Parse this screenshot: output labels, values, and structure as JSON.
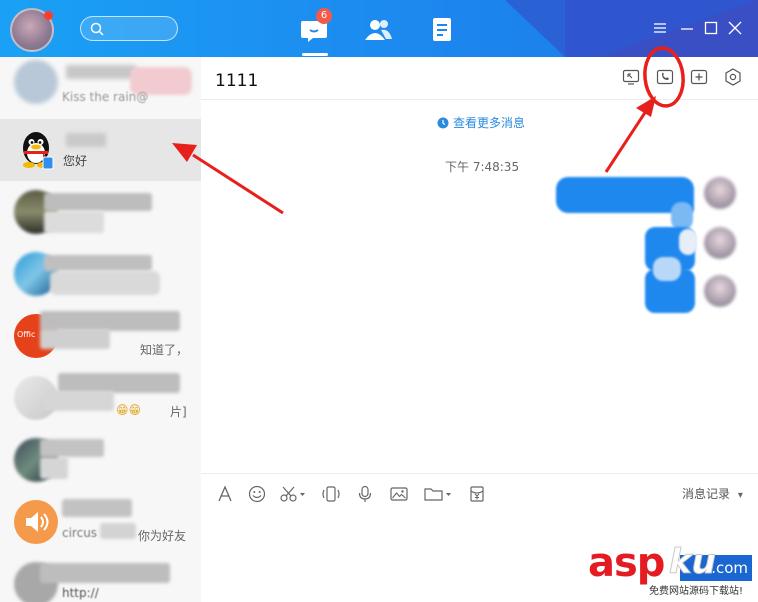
{
  "topbar": {
    "search_icon": "search-icon",
    "nav": [
      {
        "name": "chat-icon",
        "badge": "6"
      },
      {
        "name": "contacts-icon"
      },
      {
        "name": "space-icon"
      }
    ],
    "window_controls": [
      "menu-icon",
      "minimize-icon",
      "maximize-icon",
      "close-icon"
    ],
    "accent_color": "#1d86ee"
  },
  "sidebar": {
    "items": [
      {
        "preview": "Kiss the rain@"
      },
      {
        "preview": "您好"
      },
      {
        "preview": ""
      },
      {
        "preview": ""
      },
      {
        "preview": "知道了，"
      },
      {
        "preview": "片]"
      },
      {
        "preview": ""
      },
      {
        "preview": "circus",
        "tail": "你为好友"
      },
      {
        "preview": "http://"
      }
    ]
  },
  "chat": {
    "title": "1111",
    "header_icons": [
      "share-screen-icon",
      "voice-call-icon",
      "add-member-icon",
      "settings-icon"
    ],
    "more_messages": "查看更多消息",
    "timestamp": "下午 7:48:35",
    "toolbar": [
      "font-icon",
      "emoji-icon",
      "screenshot-icon",
      "shake-icon",
      "voice-icon",
      "image-icon",
      "folder-icon",
      "red-packet-icon"
    ],
    "message_record": "消息记录",
    "dropdown_arrow": "▾"
  },
  "watermark": {
    "asp": "asp",
    "ku": "ku",
    "com": ".com",
    "sub": "免费网站源码下载站!"
  }
}
